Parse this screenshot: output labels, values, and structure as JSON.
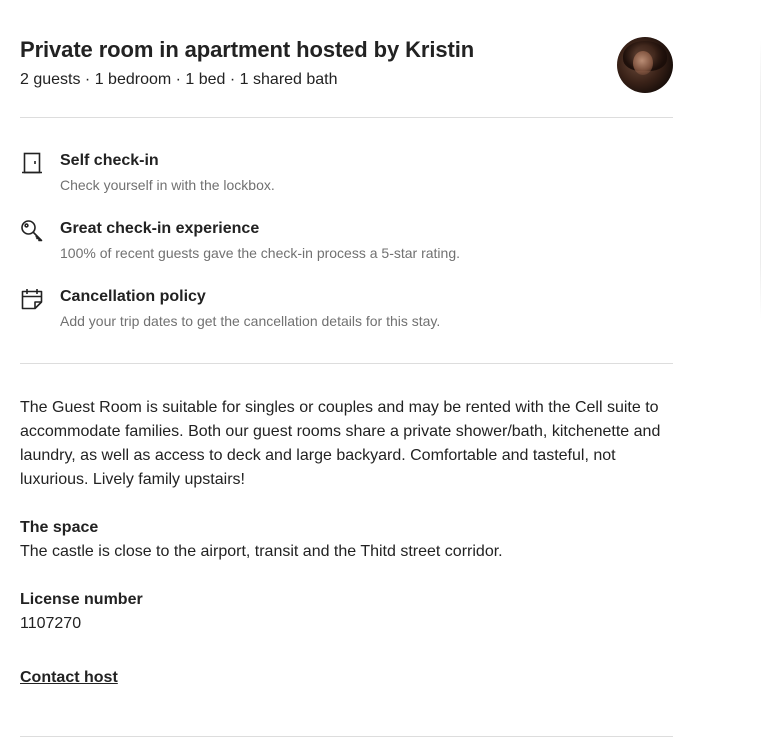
{
  "header": {
    "title": "Private room in apartment hosted by Kristin",
    "subtitle": "2 guests · 1 bedroom · 1 bed · 1 shared bath"
  },
  "highlights": [
    {
      "icon": "door-icon",
      "title": "Self check-in",
      "description": "Check yourself in with the lockbox."
    },
    {
      "icon": "key-icon",
      "title": "Great check-in experience",
      "description": "100% of recent guests gave the check-in process a 5-star rating."
    },
    {
      "icon": "calendar-icon",
      "title": "Cancellation policy",
      "description": "Add your trip dates to get the cancellation details for this stay."
    }
  ],
  "description": {
    "text": "The Guest Room is suitable for singles or couples and may be rented with the Cell suite to accommodate families. Both our guest rooms share a private shower/bath, kitchenette and laundry, as well as access to deck and large backyard. Comfortable and tasteful, not luxurious. Lively family upstairs!",
    "space_heading": "The space",
    "space_text": "The castle is close to the airport, transit and the Thitd street corridor.",
    "license_heading": "License number",
    "license_value": "1107270",
    "contact_label": "Contact host"
  }
}
